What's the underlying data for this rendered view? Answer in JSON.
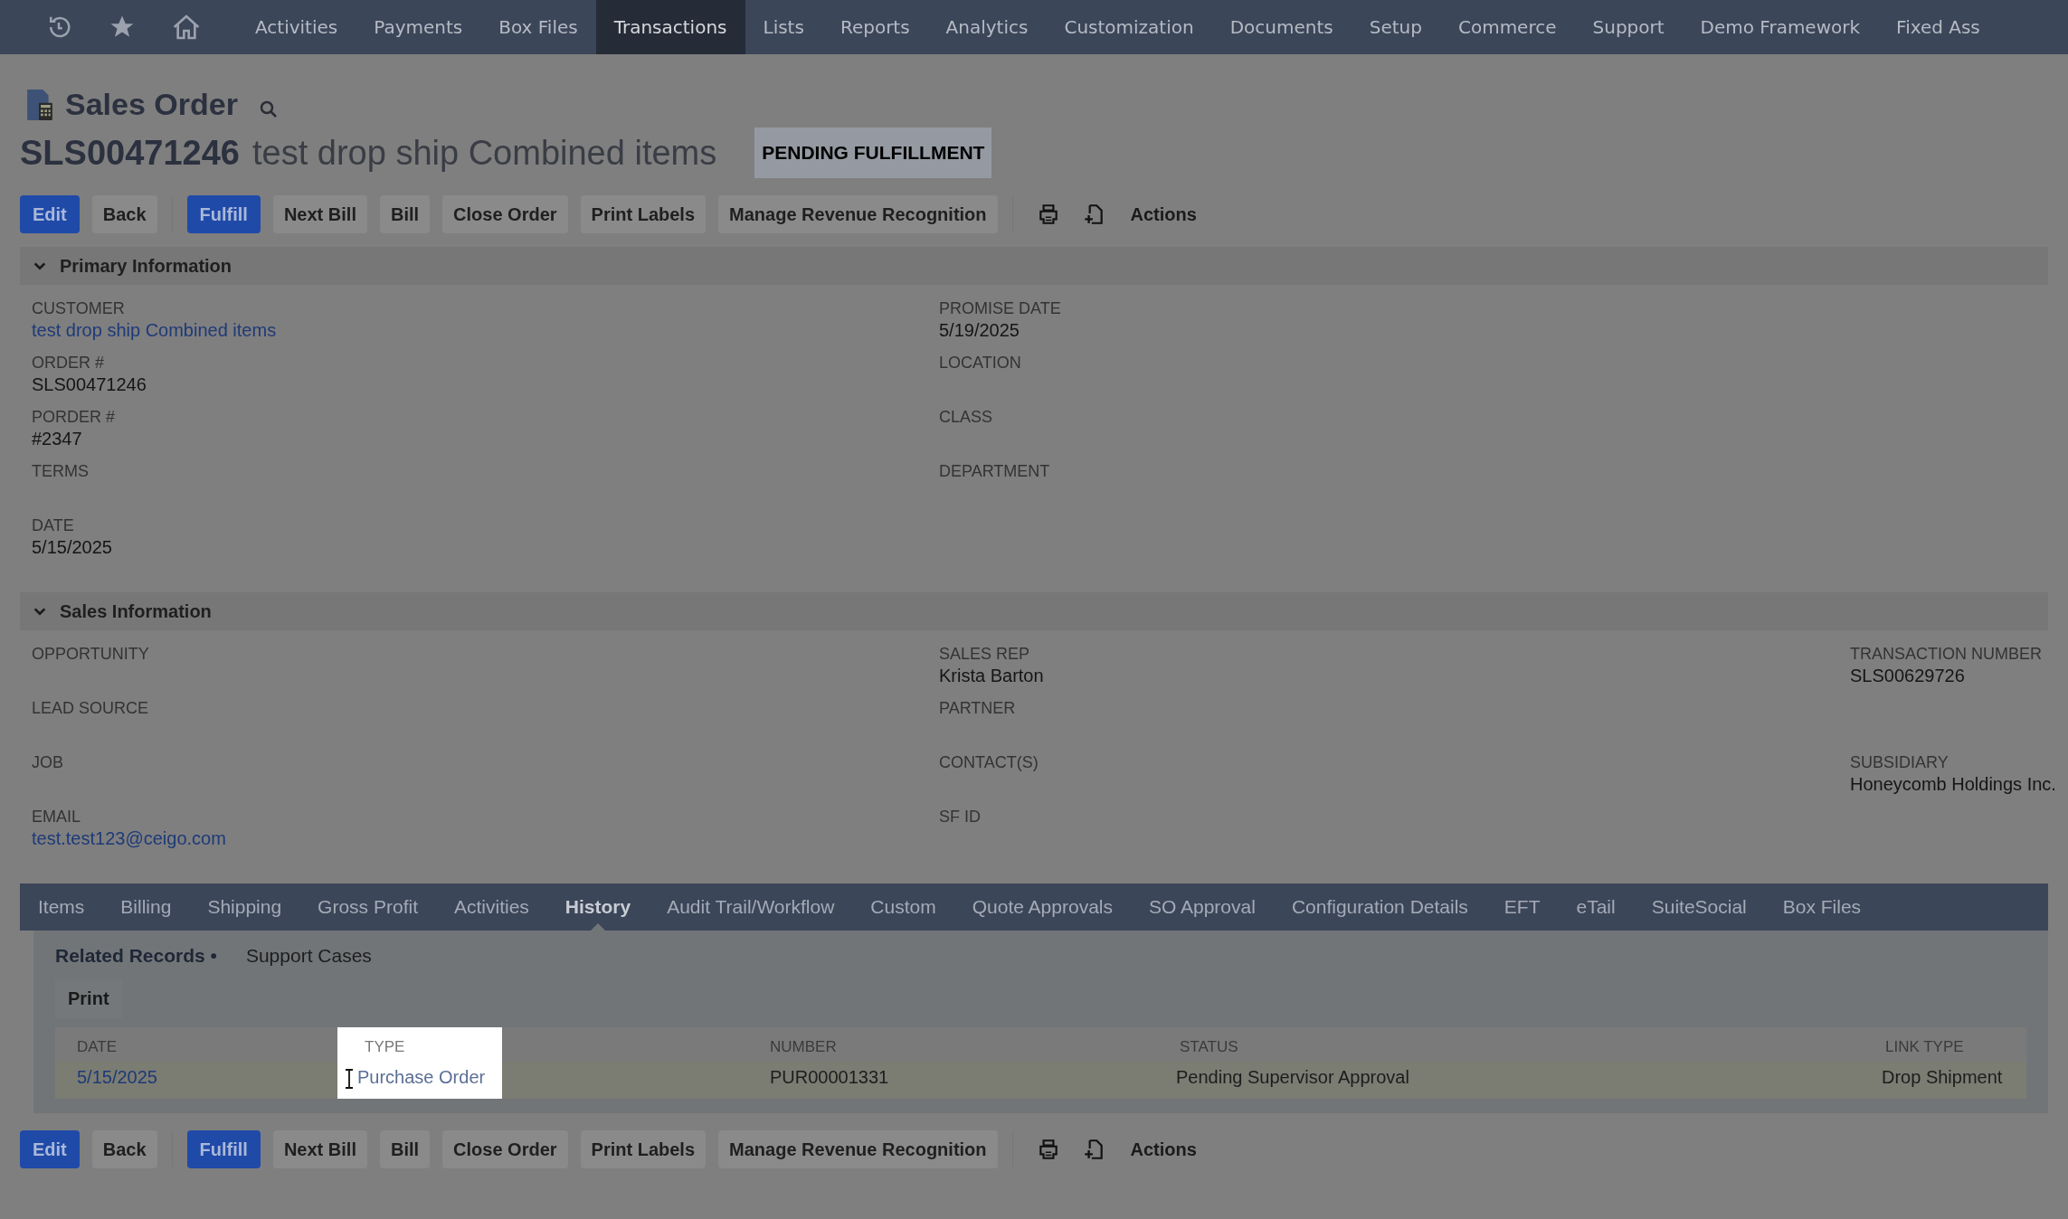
{
  "nav": {
    "items": [
      {
        "label": "Activities",
        "selected": false
      },
      {
        "label": "Payments",
        "selected": false
      },
      {
        "label": "Box Files",
        "selected": false
      },
      {
        "label": "Transactions",
        "selected": true
      },
      {
        "label": "Lists",
        "selected": false
      },
      {
        "label": "Reports",
        "selected": false
      },
      {
        "label": "Analytics",
        "selected": false
      },
      {
        "label": "Customization",
        "selected": false
      },
      {
        "label": "Documents",
        "selected": false
      },
      {
        "label": "Setup",
        "selected": false
      },
      {
        "label": "Commerce",
        "selected": false
      },
      {
        "label": "Support",
        "selected": false
      },
      {
        "label": "Demo Framework",
        "selected": false
      },
      {
        "label": "Fixed Ass",
        "selected": false
      }
    ]
  },
  "page_title": "Sales Order",
  "record": {
    "number": "SLS00471246",
    "name": "test drop ship Combined items",
    "status": "PENDING FULFILLMENT"
  },
  "toolbar_top": {
    "groups": [
      [
        {
          "label": "Edit",
          "primary": true
        },
        {
          "label": "Back",
          "primary": false
        }
      ],
      [
        {
          "label": "Fulfill",
          "primary": true
        },
        {
          "label": "Next Bill",
          "primary": false
        },
        {
          "label": "Bill",
          "primary": false
        },
        {
          "label": "Close Order",
          "primary": false
        },
        {
          "label": "Print Labels",
          "primary": false
        },
        {
          "label": "Manage Revenue Recognition",
          "primary": false
        }
      ]
    ],
    "actions": "Actions"
  },
  "sections": [
    {
      "title": "Primary Information",
      "expanded": true,
      "columns": [
        [
          {
            "kind": "field",
            "label": "CUSTOMER",
            "value": "test drop ship Combined items",
            "link": true
          },
          {
            "kind": "field",
            "label": "ORDER #",
            "value": "SLS00471246",
            "link": false
          },
          {
            "kind": "field",
            "label": "PORDER #",
            "value": "#2347",
            "link": false
          },
          {
            "kind": "field",
            "label": "TERMS"
          },
          {
            "kind": "field",
            "label": "DATE",
            "value": "5/15/2025",
            "link": false
          }
        ],
        [
          {
            "kind": "field",
            "label": "PROMISE DATE",
            "value": "5/19/2025",
            "link": false
          },
          {
            "kind": "field",
            "label": "LOCATION"
          },
          {
            "kind": "field",
            "label": "CLASS"
          },
          {
            "kind": "field",
            "label": "DEPARTMENT"
          }
        ],
        []
      ]
    },
    {
      "title": "Sales Information",
      "expanded": true,
      "columns": [
        [
          {
            "kind": "field",
            "label": "OPPORTUNITY"
          },
          {
            "kind": "field",
            "label": "LEAD SOURCE"
          },
          {
            "kind": "field",
            "label": "JOB"
          },
          {
            "kind": "field",
            "label": "EMAIL",
            "value": "test.test123@ceigo.com",
            "link": true
          }
        ],
        [
          {
            "kind": "field",
            "label": "SALES REP",
            "value": "Krista Barton",
            "link": false
          },
          {
            "kind": "field",
            "label": "PARTNER"
          },
          {
            "kind": "field",
            "label": "CONTACT(S)"
          },
          {
            "kind": "field",
            "label": "SF ID"
          }
        ],
        [
          {
            "kind": "field",
            "label": "TRANSACTION NUMBER",
            "value": "SLS00629726",
            "link": false
          },
          {
            "kind": "blank"
          },
          {
            "kind": "field",
            "label": "SUBSIDIARY",
            "value": "Honeycomb Holdings Inc.",
            "link": false
          }
        ]
      ]
    }
  ],
  "subtabs": [
    {
      "label": "Items",
      "selected": false
    },
    {
      "label": "Billing",
      "selected": false
    },
    {
      "label": "Shipping",
      "selected": false
    },
    {
      "label": "Gross Profit",
      "selected": false
    },
    {
      "label": "Activities",
      "selected": false
    },
    {
      "label": "History",
      "selected": true
    },
    {
      "label": "Audit Trail/Workflow",
      "selected": false
    },
    {
      "label": "Custom",
      "selected": false
    },
    {
      "label": "Quote Approvals",
      "selected": false
    },
    {
      "label": "SO Approval",
      "selected": false
    },
    {
      "label": "Configuration Details",
      "selected": false
    },
    {
      "label": "EFT",
      "selected": false
    },
    {
      "label": "eTail",
      "selected": false
    },
    {
      "label": "SuiteSocial",
      "selected": false
    },
    {
      "label": "Box Files",
      "selected": false
    }
  ],
  "history": {
    "tabs": [
      {
        "label": "Related Records •",
        "selected": true
      },
      {
        "label": "Support Cases",
        "selected": false
      }
    ],
    "print_button": "Print",
    "table": {
      "columns": [
        {
          "label": "DATE",
          "highlighted": false
        },
        {
          "label": "TYPE",
          "highlighted": true
        },
        {
          "label": "NUMBER",
          "highlighted": false
        },
        {
          "label": "STATUS",
          "highlighted": false
        },
        {
          "label": "LINK TYPE",
          "highlighted": false
        }
      ],
      "rows": [
        {
          "date": "5/15/2025",
          "type": "Purchase Order",
          "number": "PUR00001331",
          "status": "Pending Supervisor Approval",
          "link_type": "Drop Shipment"
        }
      ]
    }
  },
  "toolbar_bottom": {
    "groups": [
      [
        {
          "label": "Edit",
          "primary": true
        },
        {
          "label": "Back",
          "primary": false
        }
      ],
      [
        {
          "label": "Fulfill",
          "primary": true
        },
        {
          "label": "Next Bill",
          "primary": false
        },
        {
          "label": "Bill",
          "primary": false
        },
        {
          "label": "Close Order",
          "primary": false
        },
        {
          "label": "Print Labels",
          "primary": false
        },
        {
          "label": "Manage Revenue Recognition",
          "primary": false
        }
      ]
    ],
    "actions": "Actions"
  }
}
